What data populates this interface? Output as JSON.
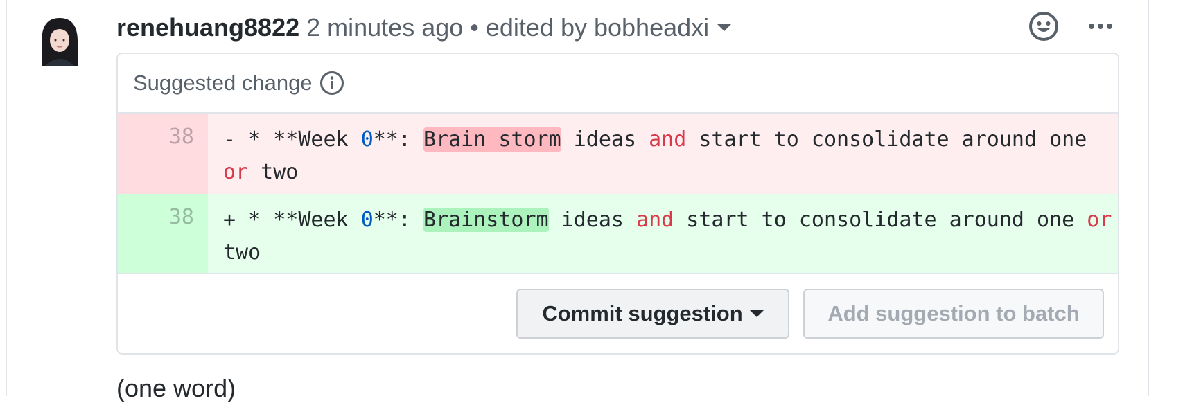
{
  "comment": {
    "author": "renehuang8822",
    "meta": "2 minutes ago • edited by bobheadxi",
    "body": "(one word)"
  },
  "icons": {
    "reaction": "smiley-icon",
    "more": "kebab-horizontal-icon",
    "info": "info-icon",
    "dropdown": "triangle-down-icon"
  },
  "suggestion": {
    "title": "Suggested change",
    "removed": {
      "line_number": "38",
      "segments": [
        {
          "text": "- * **Week ",
          "type": "plain"
        },
        {
          "text": "0",
          "type": "num"
        },
        {
          "text": "**: ",
          "type": "plain"
        },
        {
          "text": "Brain storm",
          "type": "hl"
        },
        {
          "text": " ideas ",
          "type": "plain"
        },
        {
          "text": "and",
          "type": "kw"
        },
        {
          "text": " start to consolidate around one ",
          "type": "plain"
        },
        {
          "text": "or",
          "type": "kw"
        },
        {
          "text": " two",
          "type": "plain"
        }
      ]
    },
    "added": {
      "line_number": "38",
      "segments": [
        {
          "text": "+ * **Week ",
          "type": "plain"
        },
        {
          "text": "0",
          "type": "num"
        },
        {
          "text": "**: ",
          "type": "plain"
        },
        {
          "text": "Brainstorm",
          "type": "hl"
        },
        {
          "text": " ideas ",
          "type": "plain"
        },
        {
          "text": "and",
          "type": "kw"
        },
        {
          "text": " start to consolidate around one ",
          "type": "plain"
        },
        {
          "text": "or",
          "type": "kw"
        },
        {
          "text": " two",
          "type": "plain"
        }
      ]
    },
    "commit_label": "Commit suggestion",
    "batch_label": "Add suggestion to batch"
  },
  "colors": {
    "deleted_bg": "#ffeef0",
    "added_bg": "#e6ffed",
    "keyword": "#d73a49",
    "number": "#005cc5"
  }
}
